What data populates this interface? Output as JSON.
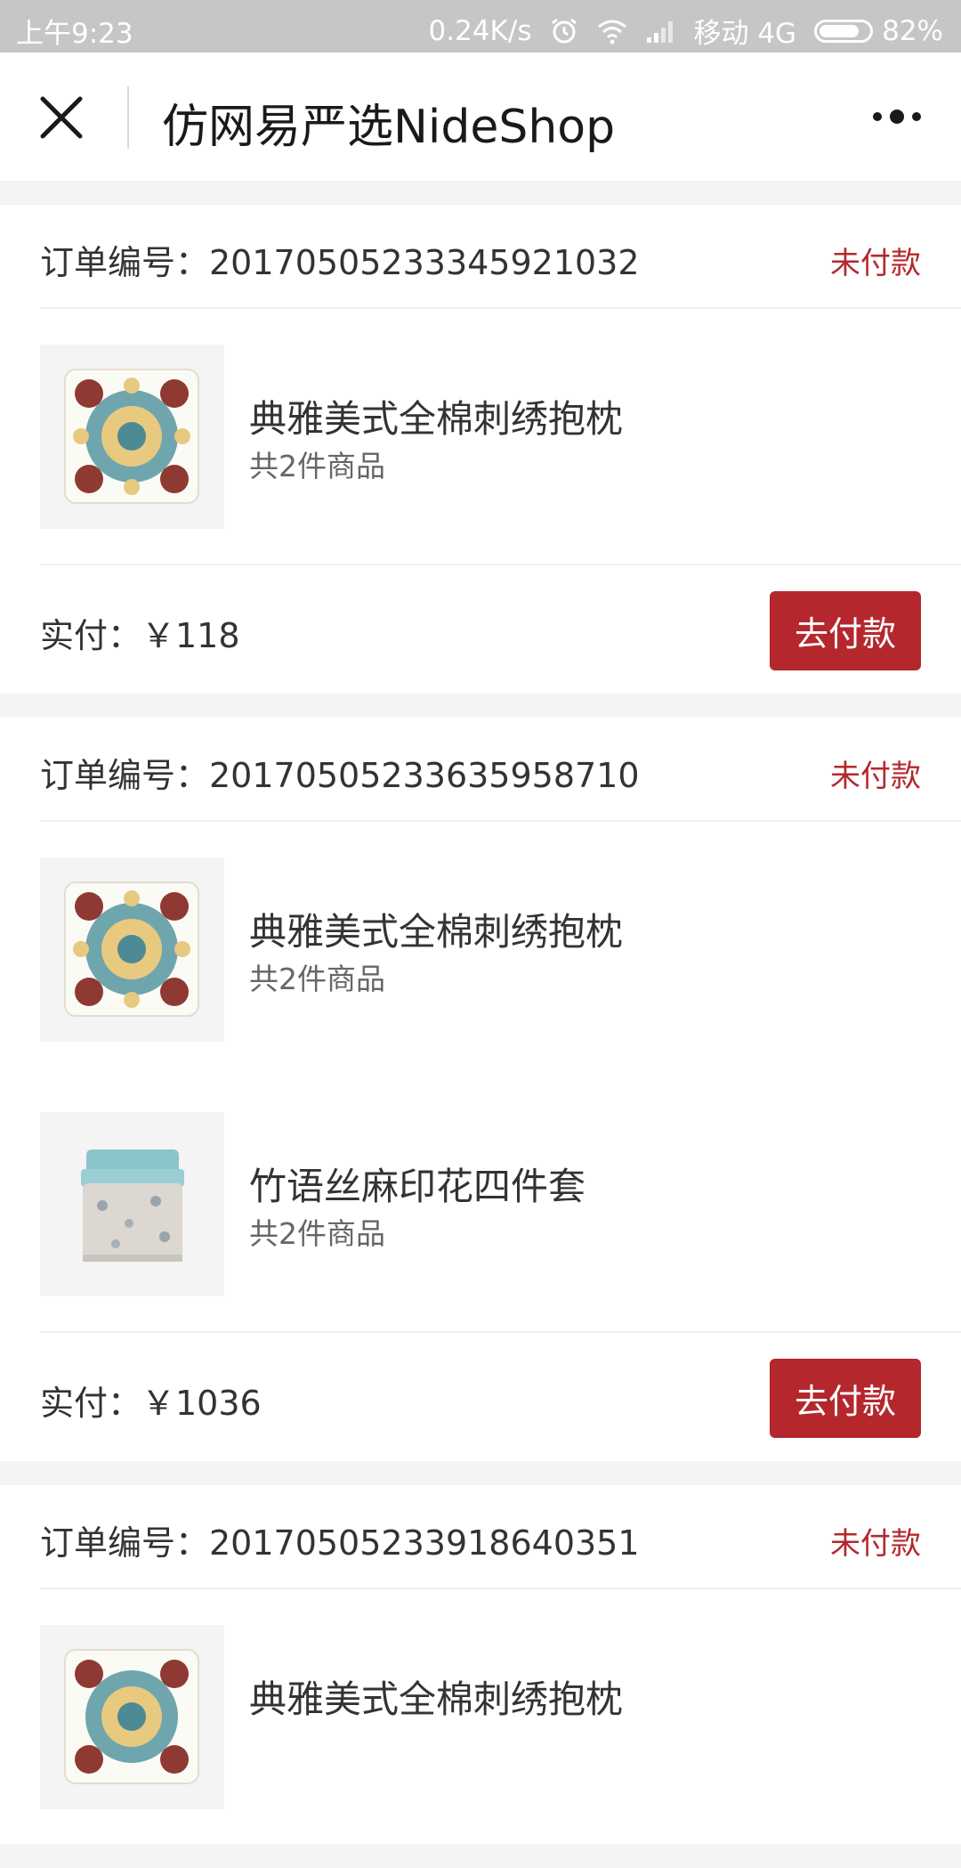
{
  "status_bar": {
    "time": "上午9:23",
    "net_speed": "0.24K/s",
    "carrier": "移动 4G",
    "battery": "82%",
    "battery_level": 0.82
  },
  "nav": {
    "title": "仿网易严选NideShop"
  },
  "orders": [
    {
      "number_label": "订单编号：20170505233345921032",
      "status": "未付款",
      "items": [
        {
          "name": "典雅美式全棉刺绣抱枕",
          "count": "共2件商品",
          "image": "pillow"
        }
      ],
      "paid": "实付：￥118",
      "button": "去付款"
    },
    {
      "number_label": "订单编号：20170505233635958710",
      "status": "未付款",
      "items": [
        {
          "name": "典雅美式全棉刺绣抱枕",
          "count": "共2件商品",
          "image": "pillow"
        },
        {
          "name": "竹语丝麻印花四件套",
          "count": "共2件商品",
          "image": "bedding"
        }
      ],
      "paid": "实付：￥1036",
      "button": "去付款"
    },
    {
      "number_label": "订单编号：20170505233918640351",
      "status": "未付款",
      "items": [
        {
          "name": "典雅美式全棉刺绣抱枕",
          "count": "",
          "image": "pillow"
        }
      ],
      "paid": "",
      "button": ""
    }
  ],
  "colors": {
    "accent": "#b4282d",
    "status_bar": "#c6c6c6",
    "background": "#f4f4f4"
  }
}
